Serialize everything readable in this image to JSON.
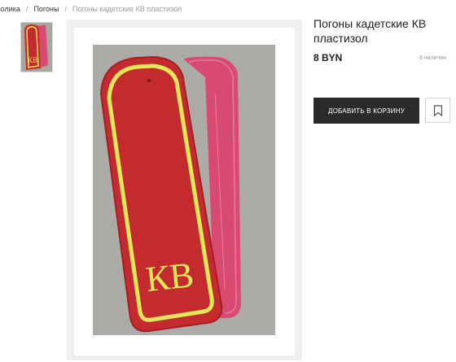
{
  "breadcrumb": {
    "items": [
      "волика",
      "Погоны"
    ],
    "separator": "/",
    "current": "Погоны кадетские КВ пластизол"
  },
  "product": {
    "title": "Погоны кадетские КВ пластизол",
    "price": "8 BYN",
    "stock": "8 наличии",
    "add_to_cart_label": "ДОБАВИТЬ В КОРЗИНУ",
    "image_letters": "КВ"
  },
  "icons": {
    "bookmark": "bookmark-icon"
  },
  "colors": {
    "button_bg": "#2b2b2b",
    "epaulette_red": "#c42b2e",
    "epaulette_trim": "#e3e85a",
    "epaulette_back": "#d94a72"
  }
}
